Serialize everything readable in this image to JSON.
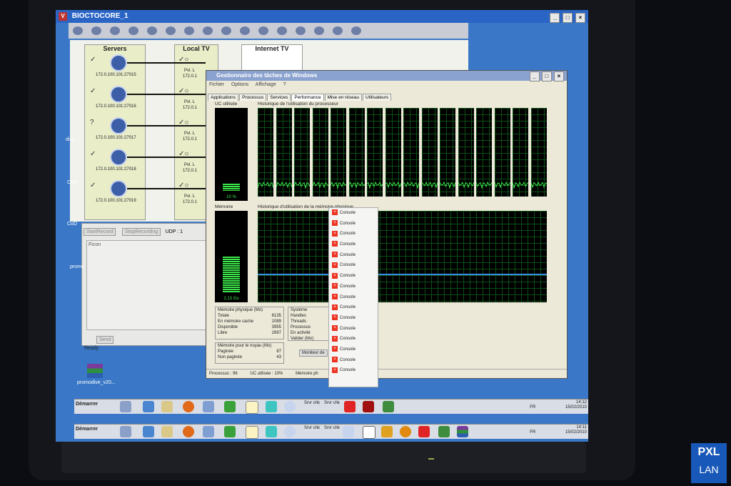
{
  "app": {
    "title": "BIOCTOCORE_1",
    "icon_name": "app-icon",
    "controls": [
      "_",
      "□",
      "×"
    ]
  },
  "panel": {
    "servers_header": "Servers",
    "localtv_header": "Local TV",
    "internettv_header": "Internet TV",
    "servers": [
      {
        "ip": "172.0.100.101:27015"
      },
      {
        "ip": "172.0.100.101:27016"
      },
      {
        "ip": "172.0.100.101:27017",
        "status": "?"
      },
      {
        "ip": "172.0.100.101:27018"
      },
      {
        "ip": "172.0.100.101:27019"
      }
    ],
    "client_label": "Pvl. L",
    "client_ip": "172.0.1"
  },
  "lower": {
    "start_label": "StartRecord",
    "stop_label": "StopRecording",
    "udp_label": "UDP : 1",
    "ficon_label": "Ficon",
    "send_label": "Send",
    "status": "Ready"
  },
  "taskmgr": {
    "title": "Gestionnaire des tâches de Windows",
    "menu": [
      "Fichier",
      "Options",
      "Affichage",
      "?"
    ],
    "tabs": [
      "Applications",
      "Processus",
      "Services",
      "Performance",
      "Mise en réseau",
      "Utilisateurs"
    ],
    "active_tab": "Performance",
    "cpu_label": "UC utilisée",
    "cpu_value": "10 %",
    "cpu_history_label": "Historique de l'utilisation du processeur",
    "mem_label": "Mémoire",
    "mem_value": "2,13 Go",
    "mem_history_label": "Historique d'utilisation de la mémoire physique",
    "phys_mem": {
      "title": "Mémoire physique (Mo)",
      "rows": [
        [
          "Totale",
          "6135"
        ],
        [
          "En mémoire cache",
          "1089"
        ],
        [
          "Disponible",
          "3955"
        ],
        [
          "Libre",
          "2897"
        ]
      ]
    },
    "system": {
      "title": "Système",
      "rows": [
        "Handles",
        "Threads",
        "Processus",
        "En activité",
        "Valider (Mo)"
      ]
    },
    "kernel": {
      "title": "Mémoire pour le noyau (Mo)",
      "rows": [
        [
          "Paginée",
          "87"
        ],
        [
          "Non paginée",
          "43"
        ]
      ]
    },
    "monitor_btn": "Moniteur de",
    "status": {
      "processes": "Processus : 96",
      "cpu": "UC utilisée : 10%",
      "mem": "Mémoire ph"
    }
  },
  "consoles": [
    "Console",
    "Console",
    "Console",
    "Console",
    "Console",
    "Console",
    "Console",
    "Console",
    "Console",
    "Console",
    "Console",
    "Console",
    "Console",
    "Console",
    "Console",
    "Console"
  ],
  "desktop": {
    "rar_label": "promodive_v20...",
    "left_labels": [
      "dire",
      "CoD",
      "CoD",
      "promo"
    ]
  },
  "taskbar": {
    "start": "Démarrer",
    "labels": [
      "Srvr chk",
      "Srvr chk"
    ],
    "tray_lang": "FR",
    "time1": "14:12",
    "date1": "15/02/2010",
    "time2": "14:11",
    "date2": "15/02/2010"
  },
  "brand": {
    "logo_text": "LAN",
    "logo_mark": "PXL",
    "colors": {
      "brand_blue": "#1858b8",
      "logo_red": "#d82020"
    }
  }
}
